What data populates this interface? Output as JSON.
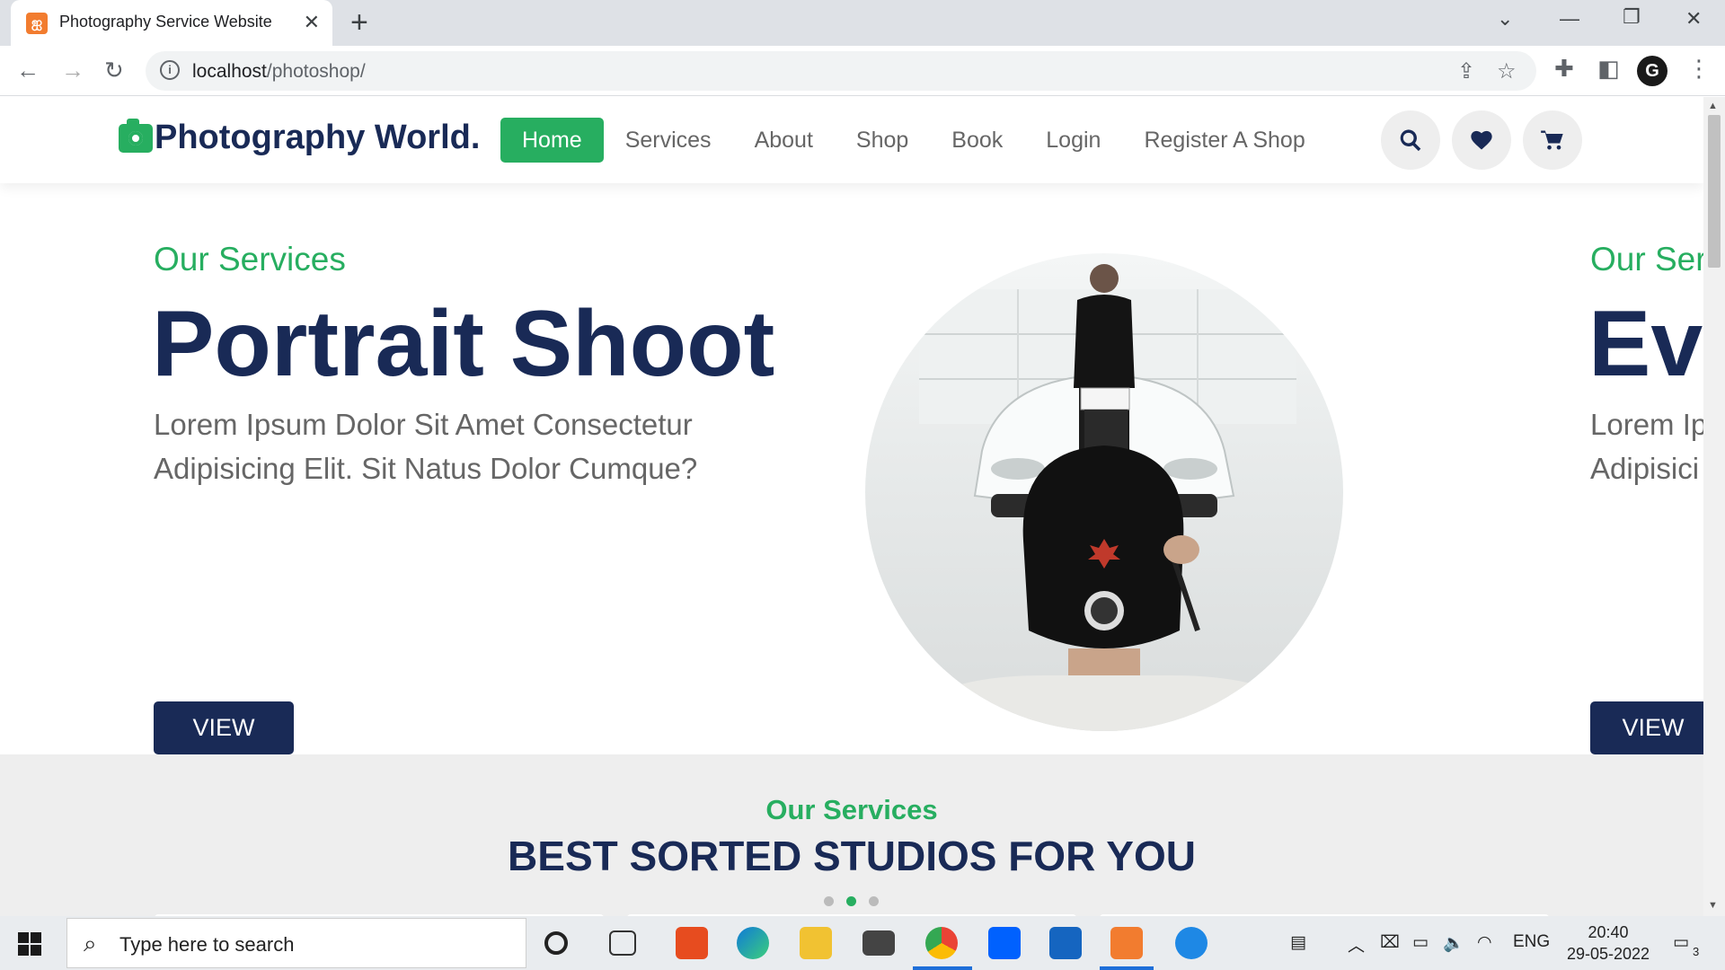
{
  "browser": {
    "tab_title": "Photography Service Website",
    "url_host": "localhost",
    "url_path": "/photoshop/"
  },
  "site": {
    "logo_text": "Photography World.",
    "nav": [
      {
        "label": "Home",
        "active": true
      },
      {
        "label": "Services",
        "active": false
      },
      {
        "label": "About",
        "active": false
      },
      {
        "label": "Shop",
        "active": false
      },
      {
        "label": "Book",
        "active": false
      },
      {
        "label": "Login",
        "active": false
      },
      {
        "label": "Register A Shop",
        "active": false
      }
    ],
    "header_icons": [
      "search-icon",
      "heart-icon",
      "cart-icon"
    ],
    "colors": {
      "accent": "#27ae60",
      "navy": "#192a56",
      "text_gray": "#666666",
      "section_bg": "#eeeeee"
    }
  },
  "hero": {
    "current": {
      "eyebrow": "Our Services",
      "title": "Portrait Shoot",
      "desc_line1": "Lorem Ipsum Dolor Sit Amet Consectetur",
      "desc_line2": "Adipisicing Elit. Sit Natus Dolor Cumque?",
      "button": "VIEW"
    },
    "next_partial": {
      "eyebrow": "Our Ser",
      "title": "Ev",
      "desc_line1": "Lorem Ip",
      "desc_line2": "Adipisici",
      "button": "VIEW"
    }
  },
  "services": {
    "eyebrow": "Our Services",
    "heading": "BEST SORTED STUDIOS FOR YOU",
    "carousel_dots": 3,
    "active_dot": 2
  },
  "taskbar": {
    "search_placeholder": "Type here to search",
    "language": "ENG",
    "time": "20:40",
    "date": "29-05-2022",
    "notifications": "3"
  }
}
